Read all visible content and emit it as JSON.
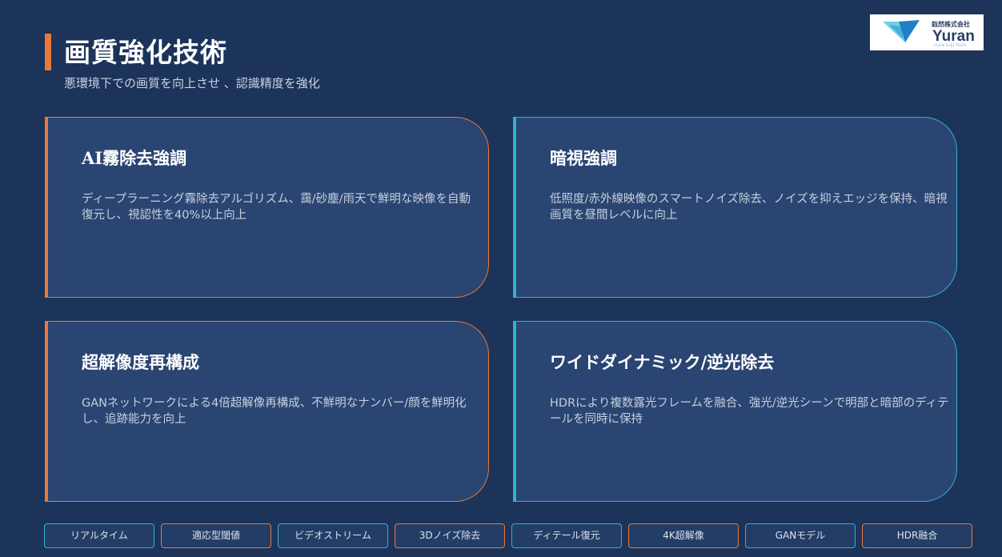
{
  "header": {
    "title": "画質強化技術",
    "subtitle": "悪環境下での画質を向上させ 、認識精度を強化"
  },
  "logo": {
    "company": "鈺然株式会社",
    "name": "Yuran",
    "tagline": "YUAN ELECTRON"
  },
  "cards": [
    {
      "title": "AI霧除去強調",
      "description": "ディープラーニング霧除去アルゴリズム、靄/砂塵/雨天で鮮明な映像を自動復元し、視認性を40%以上向上",
      "accent": "#e8793b"
    },
    {
      "title": "暗視強調",
      "description": "低照度/赤外線映像のスマートノイズ除去、ノイズを抑えエッジを保持、暗視画質を昼間レベルに向上",
      "accent": "#31b2cf"
    },
    {
      "title": "超解像度再構成",
      "description": "GANネットワークによる4倍超解像再構成、不鮮明なナンバー/顔を鮮明化し、追跡能力を向上",
      "accent": "#e8793b"
    },
    {
      "title": "ワイドダイナミック/逆光除去",
      "description": "HDRにより複数露光フレームを融合、強光/逆光シーンで明部と暗部のディテールを同時に保持",
      "accent": "#31b2cf"
    }
  ],
  "tags": [
    "リアルタイム",
    "適応型閾値",
    "ビデオストリーム",
    "3Dノイズ除去",
    "ディテール復元",
    "4K超解像",
    "GANモデル",
    "HDR融合"
  ],
  "colors": {
    "background": "#1c335a",
    "card": "#2a4572",
    "orange": "#e8793b",
    "cyan": "#31b2cf"
  }
}
